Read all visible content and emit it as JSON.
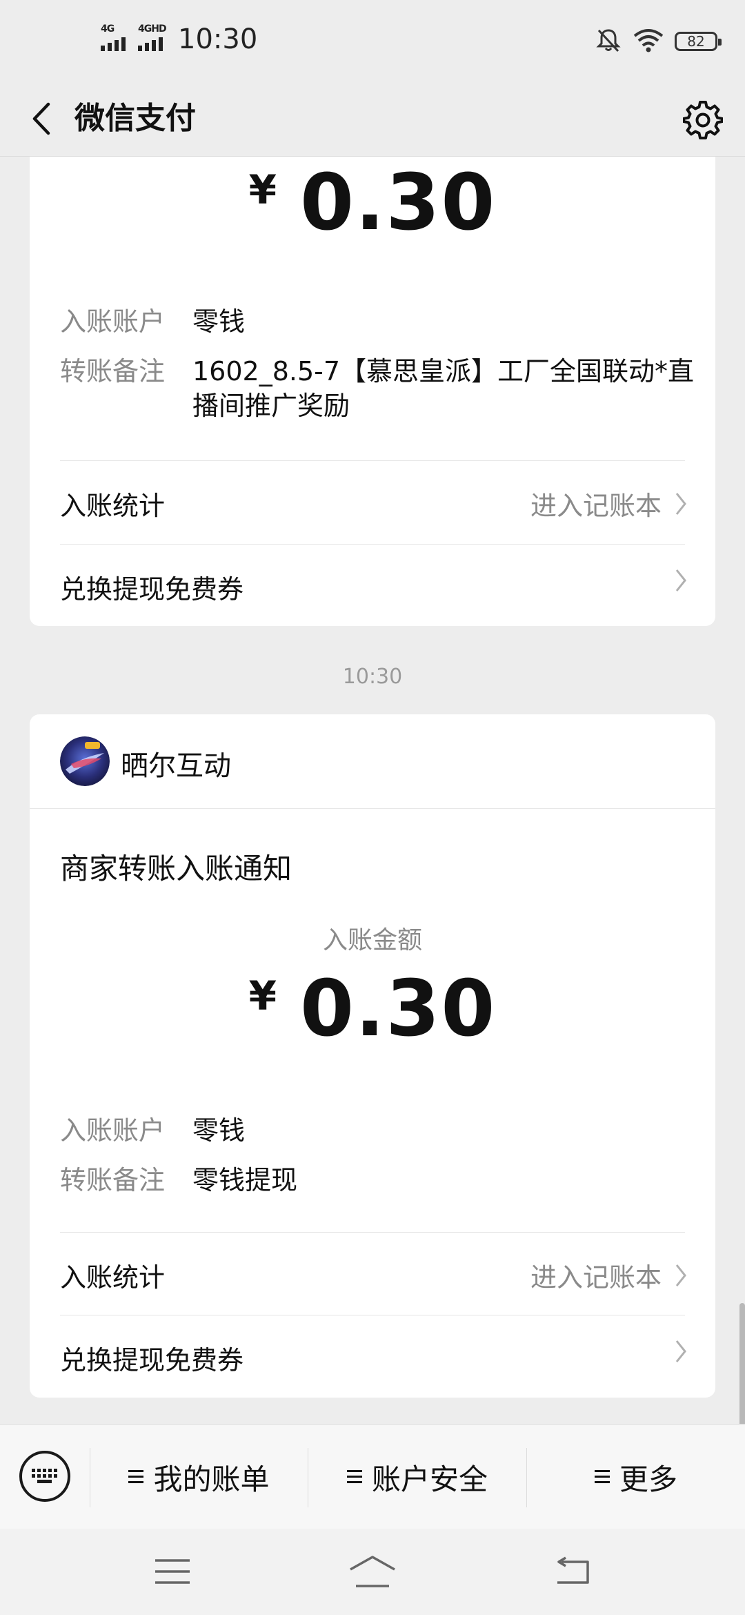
{
  "status_bar": {
    "network_1": "4G",
    "network_2": "4GHD",
    "time": "10:30",
    "battery": "82",
    "icons": [
      "mute-bell-icon",
      "wifi-icon",
      "battery-icon"
    ]
  },
  "nav": {
    "title": "微信支付",
    "back_icon": "chevron-left-icon",
    "settings_icon": "gear-icon"
  },
  "card1": {
    "currency": "¥",
    "amount": "0.30",
    "account_label": "入账账户",
    "account_value": "零钱",
    "note_label": "转账备注",
    "note_value": "1602_8.5-7【慕思皇派】工厂全国联动*直播间推广奖励",
    "stats_label": "入账统计",
    "stats_link": "进入记账本",
    "coupon_label": "兑换提现免费券"
  },
  "time_separator": "10:30",
  "card2": {
    "merchant_name": "晒尔互动",
    "notice_title": "商家转账入账通知",
    "amount_label": "入账金额",
    "currency": "¥",
    "amount": "0.30",
    "account_label": "入账账户",
    "account_value": "零钱",
    "note_label": "转账备注",
    "note_value": "零钱提现",
    "stats_label": "入账统计",
    "stats_link": "进入记账本",
    "coupon_label": "兑换提现免费券"
  },
  "bottom_menu": {
    "keyboard_icon": "keyboard-icon",
    "items": [
      {
        "label": "我的账单"
      },
      {
        "label": "账户安全"
      },
      {
        "label": "更多"
      }
    ]
  },
  "system_nav": {
    "icons": [
      "menu-icon",
      "home-icon",
      "back-icon"
    ]
  },
  "colors": {
    "background": "#ededed",
    "card": "#ffffff",
    "text": "#111111",
    "secondary_text": "#8a8a8a"
  }
}
